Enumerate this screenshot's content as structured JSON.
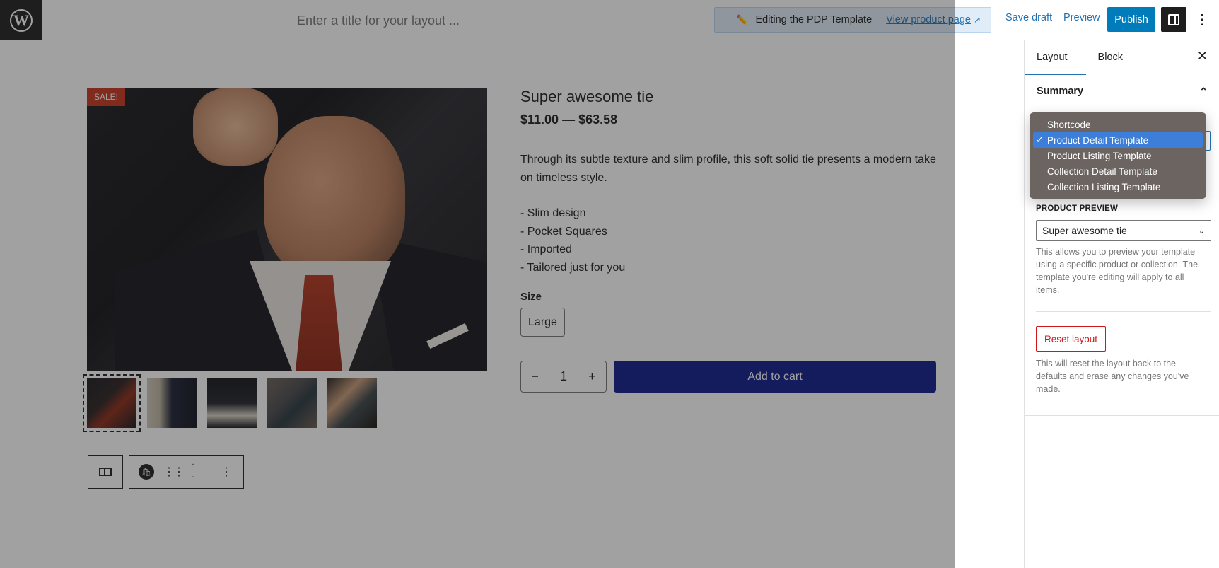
{
  "header": {
    "title_placeholder": "Enter a title for your layout ...",
    "notice_text": "Editing the PDP Template",
    "notice_link": "View product page",
    "save_draft": "Save draft",
    "preview": "Preview",
    "publish": "Publish"
  },
  "product": {
    "sale_badge": "SALE!",
    "title": "Super awesome tie",
    "price": "$11.00 — $63.58",
    "description": "Through its subtle texture and slim profile, this soft solid tie presents a modern take on timeless style.",
    "features": [
      "- Slim design",
      "- Pocket Squares",
      "- Imported",
      "- Tailored just for you"
    ],
    "size_label": "Size",
    "size_option": "Large",
    "qty_minus": "−",
    "qty_value": "1",
    "qty_plus": "+",
    "add_to_cart": "Add to cart",
    "thumbnail_count": 5,
    "selected_thumbnail": 1
  },
  "sidebar": {
    "tabs": [
      {
        "label": "Layout",
        "active": true
      },
      {
        "label": "Block",
        "active": false
      }
    ],
    "summary_title": "Summary",
    "template_options": [
      {
        "label": "Shortcode",
        "selected": false
      },
      {
        "label": "Product Detail Template",
        "selected": true
      },
      {
        "label": "Product Listing Template",
        "selected": false
      },
      {
        "label": "Collection Detail Template",
        "selected": false
      },
      {
        "label": "Collection Listing Template",
        "selected": false
      }
    ],
    "product_preview_label": "PRODUCT PREVIEW",
    "product_preview_value": "Super awesome tie",
    "product_preview_help": "This allows you to preview your template using a specific product or collection. The template you're editing will apply to all items.",
    "reset_label": "Reset layout",
    "reset_help": "This will reset the layout back to the defaults and erase any changes you've made."
  },
  "colors": {
    "accent": "#2271b1",
    "publish": "#007cba",
    "add_to_cart": "#0f1a8a",
    "danger": "#cc1818",
    "sale": "#c6351e"
  }
}
